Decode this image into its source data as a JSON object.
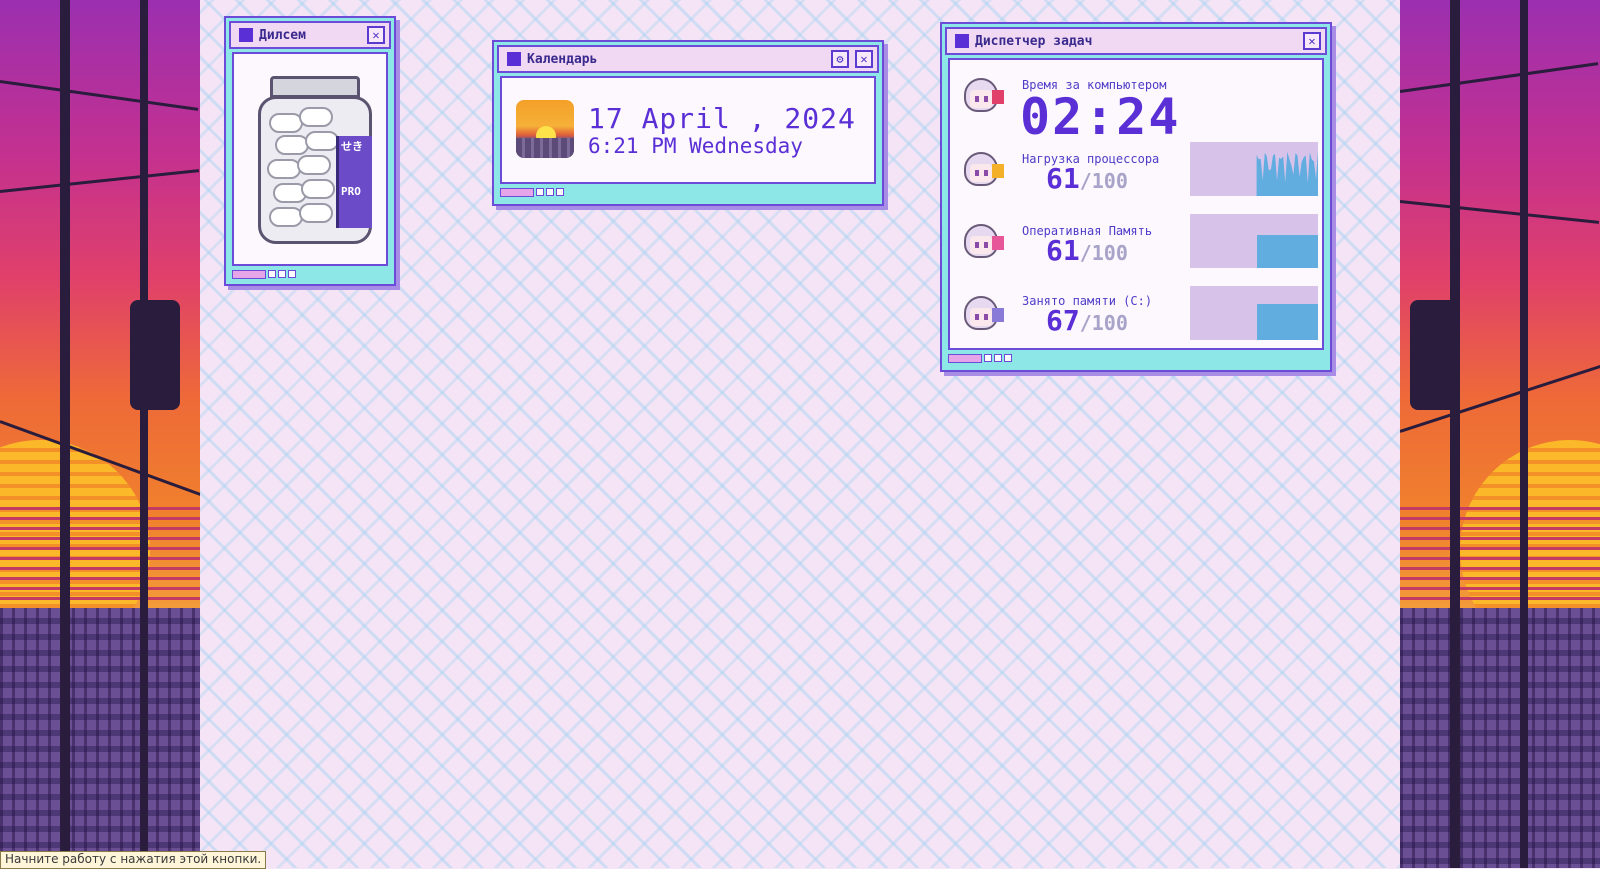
{
  "windows": {
    "pills": {
      "title": "Дилсем",
      "label_top": "せき",
      "label_bottom": "PRO"
    },
    "calendar": {
      "title": "Календарь",
      "date": "17 April , 2024",
      "time": "6:21 PM Wednesday"
    },
    "taskmanager": {
      "title": "Диспетчер задач",
      "screen_time": {
        "label": "Время за компьютером",
        "value": "02:24"
      },
      "cpu": {
        "label": "Нагрузка процессора",
        "value": "61",
        "max": "/100",
        "level": 0.61
      },
      "ram": {
        "label": "Оперативная Память",
        "value": "61",
        "max": "/100",
        "level": 0.61
      },
      "disk": {
        "label": "Занято памяти (C:)",
        "value": "67",
        "max": "/100",
        "level": 0.67
      }
    }
  },
  "status_bar": {
    "text": "Начните работу с нажатия этой кнопки."
  },
  "icons": {
    "close": "close-icon",
    "settings": "gear-icon"
  },
  "colors": {
    "accent": "#5a2fd6",
    "frame": "#8ee7e7",
    "graph_fill": "#62ade0",
    "graph_bg": "#d7c3ea"
  }
}
